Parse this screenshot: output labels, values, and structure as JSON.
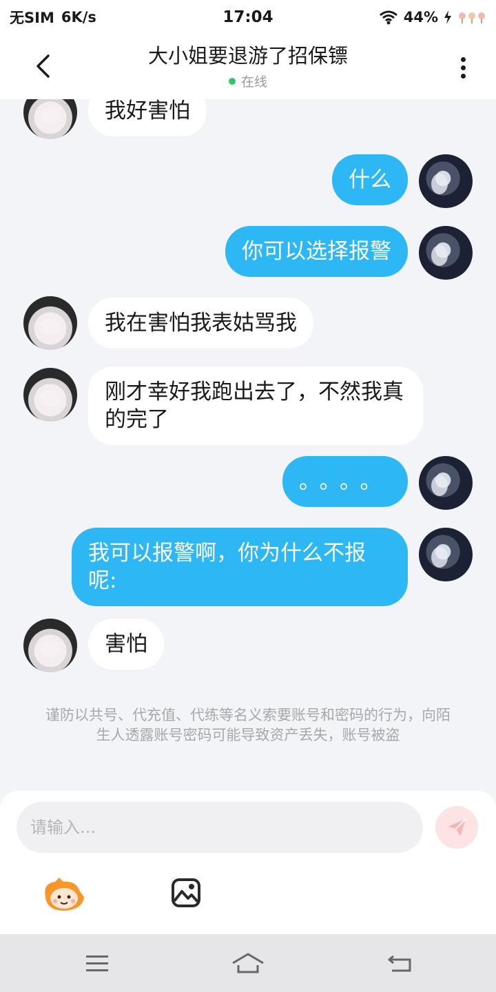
{
  "status_bar": {
    "carrier": "无SIM",
    "speed": "6K/s",
    "time": "17:04",
    "battery": "44%",
    "icons": [
      "wifi-icon",
      "charging-icon",
      "flower-icon"
    ]
  },
  "header": {
    "title": "大小姐要退游了招保镖",
    "status": "在线",
    "status_color": "#2ec866",
    "back_icon": "chevron-left-icon",
    "more_icon": "more-vertical-icon"
  },
  "messages": [
    {
      "side": "in",
      "text": "我好害怕"
    },
    {
      "side": "out",
      "text": "什么"
    },
    {
      "side": "out",
      "text": "你可以选择报警"
    },
    {
      "side": "in",
      "text": "我在害怕我表姑骂我"
    },
    {
      "side": "in",
      "text": "刚才幸好我跑出去了，不然我真的完了"
    },
    {
      "side": "out",
      "text": "。。。。"
    },
    {
      "side": "out",
      "text": "我可以报警啊，你为什么不报呢:"
    },
    {
      "side": "in",
      "text": "害怕"
    }
  ],
  "warning": "谨防以共号、代充值、代练等名义索要账号和密码的行为，向陌生人透露账号密码可能导致资产丢失，账号被盗",
  "composer": {
    "placeholder": "请输入...",
    "send_icon": "send-icon",
    "sticker_icon": "sticker-icon",
    "image_icon": "image-icon"
  },
  "nav": {
    "icons": [
      "menu-icon",
      "home-icon",
      "back-icon"
    ]
  },
  "colors": {
    "outgoing_bubble": "#2db7f5",
    "incoming_bubble": "#ffffff",
    "background": "#f2f4f8"
  }
}
